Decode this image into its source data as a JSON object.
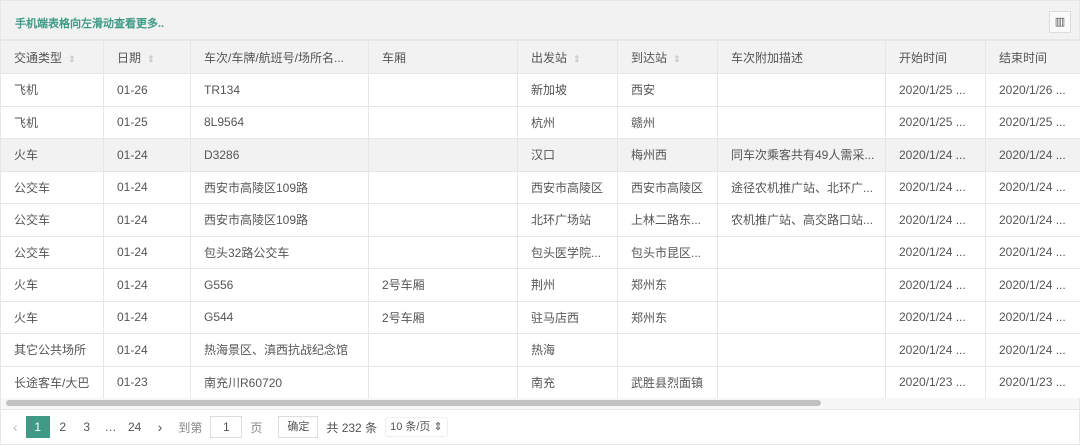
{
  "hint": "手机端表格向左滑动查看更多..",
  "columns_icon": "columns-icon",
  "headers": [
    "交通类型",
    "日期",
    "车次/车牌/航班号/场所名...",
    "车厢",
    "出发站",
    "到达站",
    "车次附加描述",
    "开始时间",
    "结束时间"
  ],
  "rows": [
    [
      "飞机",
      "01-26",
      "TR134",
      "",
      "新加坡",
      "西安",
      "",
      "2020/1/25 ...",
      "2020/1/26 ..."
    ],
    [
      "飞机",
      "01-25",
      "8L9564",
      "",
      "杭州",
      "赣州",
      "",
      "2020/1/25 ...",
      "2020/1/25 ..."
    ],
    [
      "火车",
      "01-24",
      "D3286",
      "",
      "汉口",
      "梅州西",
      "同车次乘客共有49人需采...",
      "2020/1/24 ...",
      "2020/1/24 ..."
    ],
    [
      "公交车",
      "01-24",
      "西安市高陵区109路",
      "",
      "西安市高陵区",
      "西安市高陵区",
      "途径农机推广站、北环广...",
      "2020/1/24 ...",
      "2020/1/24 ..."
    ],
    [
      "公交车",
      "01-24",
      "西安市高陵区109路",
      "",
      "北环广场站",
      "上林二路东...",
      "农机推广站、高交路口站...",
      "2020/1/24 ...",
      "2020/1/24 ..."
    ],
    [
      "公交车",
      "01-24",
      "包头32路公交车",
      "",
      "包头医学院...",
      "包头市昆区...",
      "",
      "2020/1/24 ...",
      "2020/1/24 ..."
    ],
    [
      "火车",
      "01-24",
      "G556",
      "2号车厢",
      "荆州",
      "郑州东",
      "",
      "2020/1/24 ...",
      "2020/1/24 ..."
    ],
    [
      "火车",
      "01-24",
      "G544",
      "2号车厢",
      "驻马店西",
      "郑州东",
      "",
      "2020/1/24 ...",
      "2020/1/24 ..."
    ],
    [
      "其它公共场所",
      "01-24",
      "热海景区、滇西抗战纪念馆",
      "",
      "热海",
      "",
      "",
      "2020/1/24 ...",
      "2020/1/24 ..."
    ],
    [
      "长途客车/大巴",
      "01-23",
      "南充川R60720",
      "",
      "南充",
      "武胜县烈面镇",
      "",
      "2020/1/23 ...",
      "2020/1/23 ..."
    ]
  ],
  "pager": {
    "prev": "‹",
    "pages": [
      "1",
      "2",
      "3",
      "…",
      "24"
    ],
    "next": "›",
    "goto": "到第",
    "page_value": "1",
    "page_unit": "页",
    "confirm": "确定",
    "total": "共 232 条",
    "size": "10 条/页"
  },
  "colors": {
    "accent": "#3f9a86"
  }
}
